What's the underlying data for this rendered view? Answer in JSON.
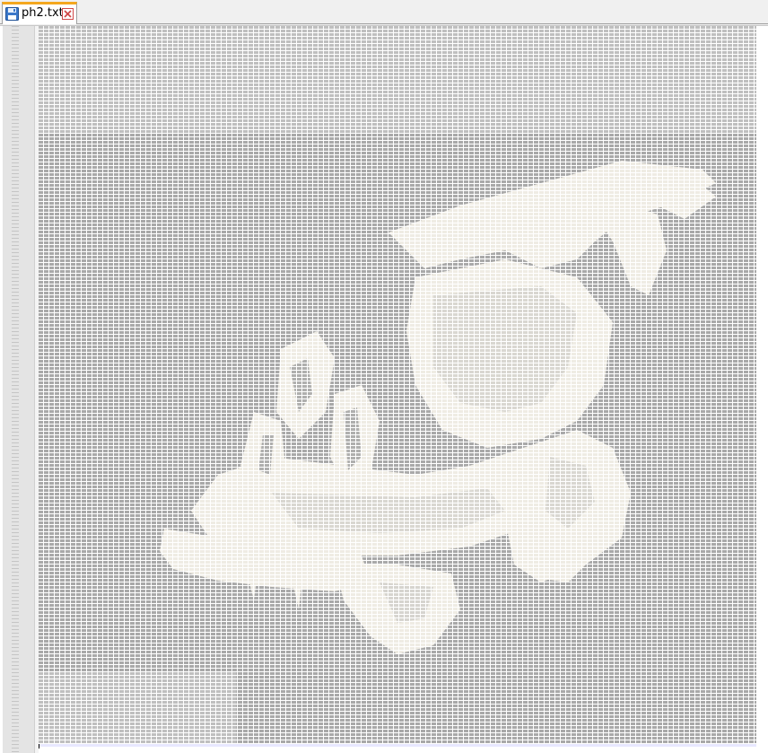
{
  "tab": {
    "filename": "ph2.txt",
    "save_icon": "floppy-disk-icon",
    "close_icon": "close-icon",
    "accent_color": "#f4a71e"
  },
  "editor": {
    "background": "#ffffff",
    "text_color": "#a8a8a8",
    "highlight_color": "#f2f0ea",
    "content_description_icon": "ascii-art-dragon-skull"
  }
}
